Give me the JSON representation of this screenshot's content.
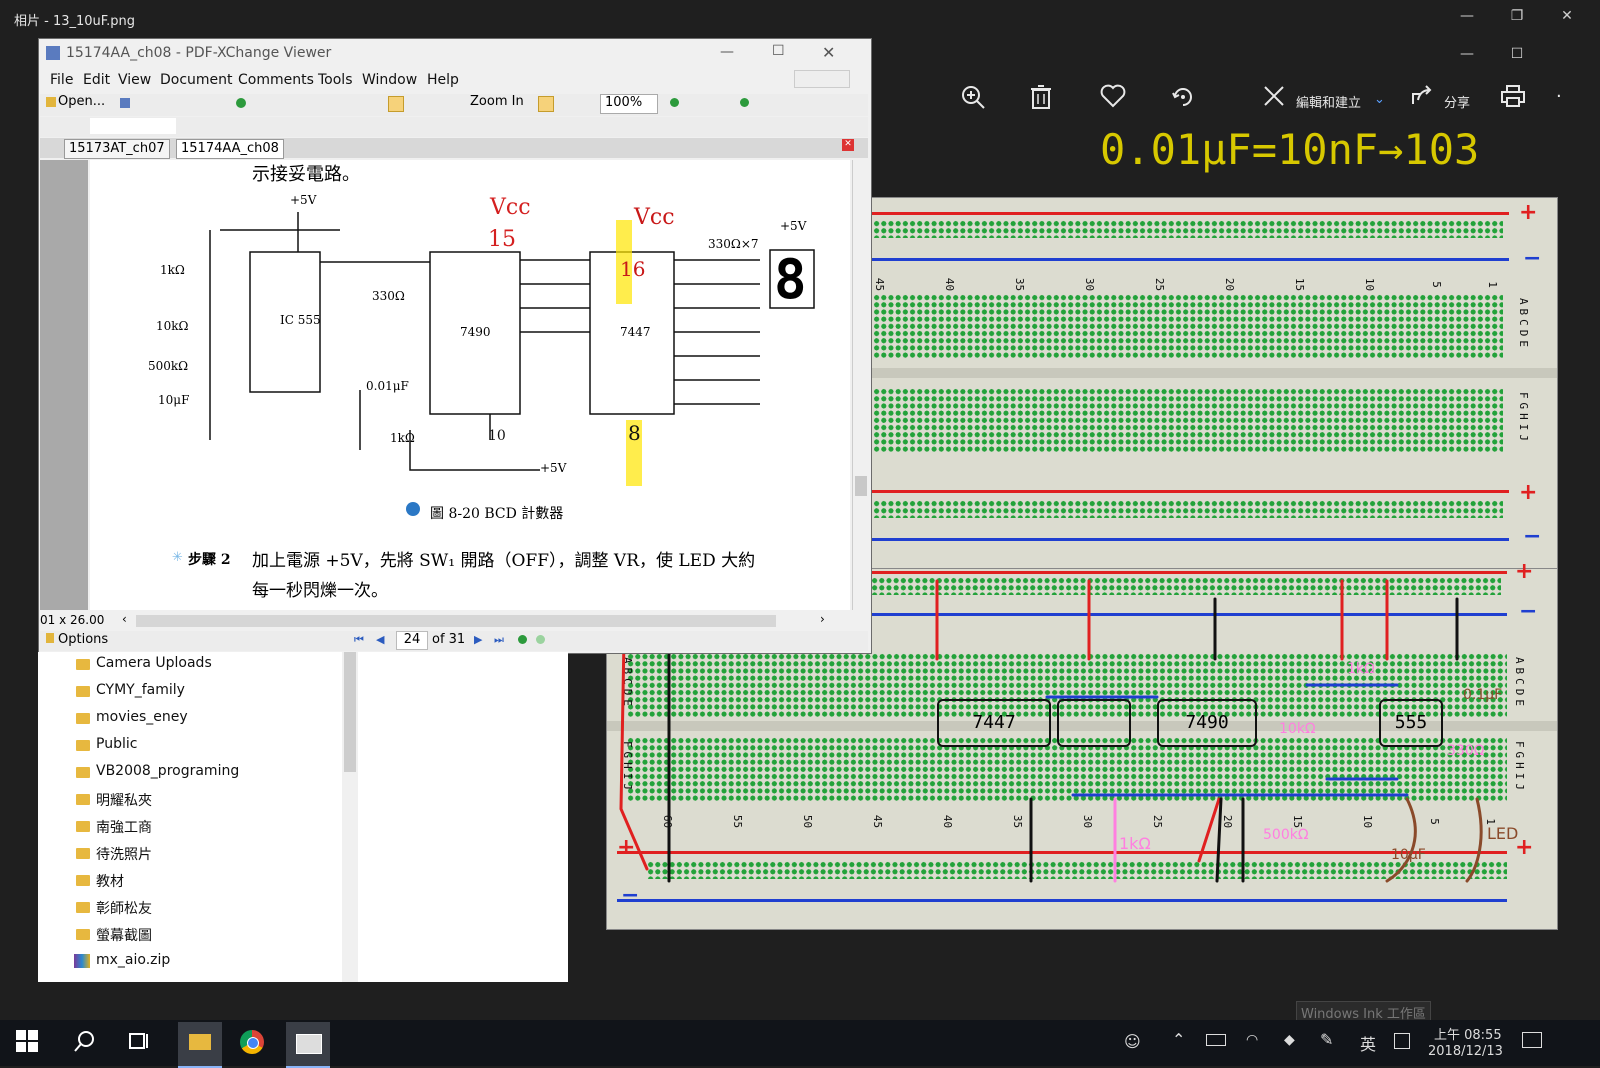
{
  "photos": {
    "title": "相片 - 13_10uF.png",
    "window_controls": [
      "—",
      "❐",
      "✕"
    ],
    "inner_controls": [
      "—",
      "☐"
    ],
    "toolbar": {
      "zoom_icon": "zoom-in-icon",
      "delete_icon": "trash-icon",
      "favorite_icon": "heart-icon",
      "rotate_icon": "rotate-icon",
      "edit_label": "編輯和建立",
      "share_label": "分享",
      "print_icon": "printer-icon",
      "more": "·"
    },
    "annotation_top": "0.01μF=10nF→103"
  },
  "breadboard": {
    "col_numbers_top": [
      "45",
      "40",
      "35",
      "30",
      "25",
      "20",
      "15",
      "10",
      "5",
      "1"
    ],
    "col_numbers_lower": [
      "60",
      "55",
      "50",
      "45",
      "40",
      "35",
      "30",
      "25",
      "20",
      "15",
      "10",
      "5",
      "1"
    ],
    "row_labels_left": "ABCDE",
    "row_labels_right": "FGHIJ",
    "plus": "+",
    "minus": "−",
    "chip_labels": [
      "7447",
      "7490",
      "555"
    ],
    "handwritten": [
      "1kΩ",
      "10kΩ",
      "1kΩ",
      "500kΩ",
      "330Ω",
      "0.1μF",
      "LED",
      "10μF",
      "0.01μF"
    ]
  },
  "pdf": {
    "title": "15174AA_ch08 - PDF-XChange Viewer",
    "menu": [
      "File",
      "Edit",
      "View",
      "Document",
      "Comments",
      "Tools",
      "Window",
      "Help"
    ],
    "toolbar": {
      "open_label": "Open...",
      "zoom_in_label": "Zoom In",
      "zoom_value": "100%"
    },
    "tabs": [
      "15173AT_ch07",
      "15174AA_ch08"
    ],
    "page_text": {
      "top_line": "示接妥電路。",
      "figure_caption": "圖 8-20  BCD 計數器",
      "step_label": "步驟 2",
      "step_text_1": "加上電源 +5V，先將 SW₁ 開路（OFF），調整 VR，使 LED 大約",
      "step_text_2": "每一秒閃爍一次。"
    },
    "schematic": {
      "plus5v": "+5V",
      "r_a": "1kΩ",
      "r_b": "10kΩ",
      "vr": "VR 500kΩ",
      "c": "10μF",
      "c2": "0.01μF",
      "r_led": "330Ω",
      "r_pull": "1kΩ",
      "seg_res": "330Ω×7",
      "ic555": "IC 555",
      "ic7490": "7490",
      "ic7447": "7447",
      "ink_vcc1": "Vcc",
      "ink_vcc2": "Vcc",
      "ink_15": "15",
      "ink_16": "16",
      "ink_10": "10",
      "ink_8": "8"
    },
    "hscroll_label": "01 x 26.00",
    "status": {
      "options_label": "Options",
      "page_current": "24",
      "page_total": "of 31"
    }
  },
  "explorer": {
    "items": [
      "Camera Uploads",
      "CYMY_family",
      "movies_eney",
      "Public",
      "VB2008_programing",
      "明耀私夾",
      "南強工商",
      "待洗照片",
      "教材",
      "彰師松友",
      "螢幕截圖",
      "mx_aio.zip"
    ]
  },
  "ink_workspace_label": "Windows Ink 工作區",
  "taskbar": {
    "time": "上午 08:55",
    "date": "2018/12/13",
    "ime": "英"
  }
}
